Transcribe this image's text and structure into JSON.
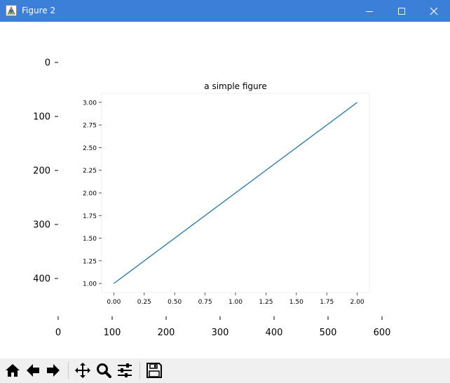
{
  "window": {
    "title": "Figure 2",
    "icons": {
      "app": "matplotlib-icon",
      "minimize": "minimize-icon",
      "maximize": "maximize-icon",
      "close": "close-icon"
    },
    "colors": {
      "titlebar": "#3b7fd9",
      "toolbar": "#f0f0f0"
    }
  },
  "toolbar": {
    "buttons": [
      {
        "name": "home-button",
        "icon": "home-icon"
      },
      {
        "name": "back-button",
        "icon": "arrow-left-icon"
      },
      {
        "name": "forward-button",
        "icon": "arrow-right-icon"
      },
      {
        "name": "pan-button",
        "icon": "move-icon"
      },
      {
        "name": "zoom-button",
        "icon": "magnifier-icon"
      },
      {
        "name": "configure-subplots-button",
        "icon": "sliders-icon"
      },
      {
        "name": "save-button",
        "icon": "floppy-disk-icon"
      }
    ]
  },
  "chart_data": [
    {
      "type": "image-axes",
      "title": "",
      "x_ticks": [
        "0",
        "100",
        "200",
        "300",
        "400",
        "500",
        "600"
      ],
      "y_ticks": [
        "0",
        "100",
        "200",
        "300",
        "400"
      ],
      "x_tick_values": [
        0,
        100,
        200,
        300,
        400,
        500,
        600
      ],
      "y_tick_values": [
        0,
        100,
        200,
        300,
        400
      ],
      "xlim": [
        0,
        600
      ],
      "ylim": [
        0,
        440
      ],
      "y_inverted": true,
      "grid": false
    },
    {
      "type": "line",
      "title": "a simple figure",
      "x": [
        0.0,
        2.0
      ],
      "y": [
        1.0,
        3.0
      ],
      "xlim": [
        -0.1,
        2.1
      ],
      "ylim": [
        0.9,
        3.1
      ],
      "x_ticks": [
        "0.00",
        "0.25",
        "0.50",
        "0.75",
        "1.00",
        "1.25",
        "1.50",
        "1.75",
        "2.00"
      ],
      "y_ticks": [
        "1.00",
        "1.25",
        "1.50",
        "1.75",
        "2.00",
        "2.25",
        "2.50",
        "2.75",
        "3.00"
      ],
      "x_tick_values": [
        0.0,
        0.25,
        0.5,
        0.75,
        1.0,
        1.25,
        1.5,
        1.75,
        2.0
      ],
      "y_tick_values": [
        1.0,
        1.25,
        1.5,
        1.75,
        2.0,
        2.25,
        2.5,
        2.75,
        3.0
      ],
      "line_color": "#1f77b4",
      "grid": false
    }
  ]
}
